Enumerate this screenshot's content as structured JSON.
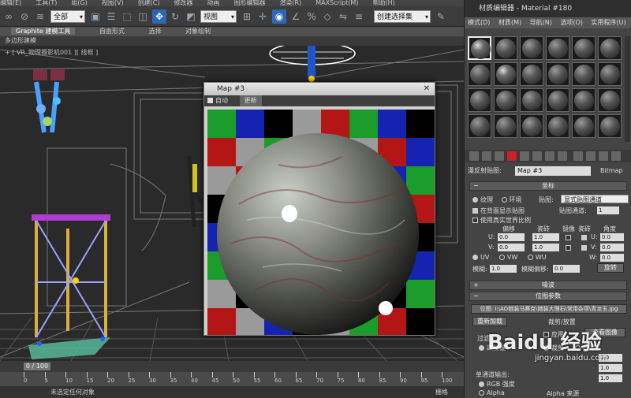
{
  "menubar": [
    "编辑(E)",
    "工具(T)",
    "组(G)",
    "视图(V)",
    "创建(C)",
    "修改器",
    "动画",
    "图形编辑器",
    "渲染(R)",
    "MAXScript(M)",
    "帮助(H)"
  ],
  "toolbar": {
    "filter_select": "全部",
    "view_select": "视图",
    "selection_set": "创建选择集",
    "icons": [
      "link-icon",
      "unlink-icon",
      "bind-icon",
      "select-object-icon",
      "select-by-name-icon",
      "rect-region-icon",
      "window-crossing-icon",
      "move-icon",
      "rotate-icon",
      "scale-icon",
      "pivot-icon",
      "manipulate-icon",
      "snap-toggle-icon",
      "angle-snap-icon",
      "percent-snap-icon",
      "spinner-snap-icon",
      "mirror-icon",
      "align-icon"
    ]
  },
  "ribbon": {
    "tabs": [
      "Graphite 建模工具",
      "自由形式",
      "选择",
      "对象绘制"
    ],
    "sub": "多边形建模",
    "viewport_label": "+ [ VR_物理摄影机001 ][ 线框 ]"
  },
  "map_dialog": {
    "title": "Map #3",
    "auto_label": "自动",
    "update_label": "更新"
  },
  "material_editor": {
    "title": "材质编辑器 - Material #180",
    "menu": [
      "模式(D)",
      "材质(M)",
      "导航(N)",
      "选项(O)",
      "实用程序(U)"
    ],
    "map_label": "漫反射贴图:",
    "map_name": "Map #3",
    "map_type": "Bitmap",
    "rollup_coords": "坐标",
    "texture_label": "纹理",
    "environ_label": "环境",
    "mapping_label": "贴图:",
    "mapping_value": "显式贴图通道",
    "show_back_label": "在背面显示贴图",
    "map_channel_label": "贴图通道:",
    "map_channel_value": "1",
    "real_world_label": "使用真实世界比例",
    "offset_label": "偏移",
    "tiling_label": "瓷砖",
    "mirror_label": "镜像",
    "tile_label": "瓷砖",
    "angle_label": "角度",
    "u_label": "U:",
    "v_label": "V:",
    "w_label": "W:",
    "u_offset": "0.0",
    "v_offset": "0.0",
    "u_tiling": "1.0",
    "v_tiling": "1.0",
    "u_angle": "0.0",
    "v_angle": "0.0",
    "w_angle": "0.0",
    "uv_label": "UV",
    "vw_label": "VW",
    "wu_label": "WU",
    "blur_label": "模糊:",
    "blur_value": "1.0",
    "blur_offset_label": "模糊偏移:",
    "blur_offset_value": "0.0",
    "rotate_button": "旋转",
    "rollup_noise": "噪波",
    "rollup_bitmap": "位图参数",
    "bitmap_path": "位图: I:\\AD她装马赛克\\她装大理石\\常用杂项\\青龙玉.jpg",
    "reload_button": "重新加载",
    "crop_group_label": "裁剪/放置",
    "apply_label": "应用",
    "view_image_button": "查看图像",
    "filter_label": "过滤",
    "pyramid_label": "四棱锥",
    "crop_label": "裁剪",
    "place_label": "放置",
    "single_channel_label": "单通道输出:",
    "rgb_label": "RGB 强度",
    "alpha_label": "Alpha",
    "alpha_source_label": "Alpha 来源",
    "spin_values": [
      "0.0",
      "1.0",
      "1.0"
    ]
  },
  "timeline": {
    "frame": "0 / 100",
    "ticks": [
      "0",
      "5",
      "10",
      "15",
      "20",
      "25",
      "30",
      "35",
      "40",
      "45",
      "50",
      "55",
      "60",
      "65",
      "70",
      "75",
      "80",
      "85",
      "90",
      "95",
      "100"
    ]
  },
  "status": {
    "text": "未选定任何对象",
    "grid_label": "栅格"
  },
  "watermark": {
    "brand": "Baidu 经验",
    "url": "jingyan.baidu.com"
  }
}
